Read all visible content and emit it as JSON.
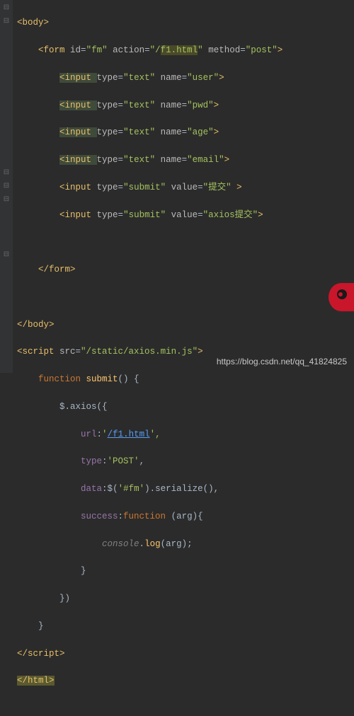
{
  "footer": "https://blog.csdn.net/qq_41824825",
  "fold": {
    "open": "⊟",
    "closed": "⊟",
    "leaf": ""
  },
  "code": {
    "l1": {
      "tag_open": "<body>"
    },
    "l2": {
      "indent": "    ",
      "open": "<form ",
      "a1n": "id",
      "a1v": "\"fm\"",
      "a2n": "action",
      "a2v1": "\"/",
      "a2v_hl": "f1.html",
      "a2v2": "\"",
      "a3n": "method",
      "a3v": "\"post\"",
      "close": ">"
    },
    "l3": {
      "indent": "        ",
      "open": "<input ",
      "a1n": "type",
      "a1v": "\"text\"",
      "a2n": "name",
      "a2v": "\"user\"",
      "close": ">"
    },
    "l4": {
      "indent": "        ",
      "open": "<input ",
      "a1n": "type",
      "a1v": "\"text\"",
      "a2n": "name",
      "a2v": "\"pwd\"",
      "close": ">"
    },
    "l5": {
      "indent": "        ",
      "open": "<input ",
      "a1n": "type",
      "a1v": "\"text\"",
      "a2n": "name",
      "a2v": "\"age\"",
      "close": ">"
    },
    "l6": {
      "indent": "        ",
      "open": "<input ",
      "a1n": "type",
      "a1v": "\"text\"",
      "a2n": "name",
      "a2v": "\"email\"",
      "close": ">"
    },
    "l7": {
      "indent": "        ",
      "open": "<input ",
      "a1n": "type",
      "a1v": "\"submit\"",
      "a2n": "value",
      "a2v": "\"提交\"",
      "close": " >"
    },
    "l8": {
      "indent": "        ",
      "open": "<input ",
      "a1n": "type",
      "a1v": "\"submit\"",
      "a2n": "value",
      "a2v": "\"axios提交\"",
      "close": ">"
    },
    "l9": "",
    "l10": {
      "indent": "    ",
      "tag": "</form>"
    },
    "l11": "",
    "l12": {
      "tag": "</body>"
    },
    "l13": {
      "open": "<script ",
      "a1n": "src",
      "a1v": "\"/static/axios.min.js\"",
      "close": ">"
    },
    "l14": {
      "indent": "    ",
      "kw": "function ",
      "name": "submit",
      "rest": "() {"
    },
    "l15": {
      "indent": "        ",
      "obj": "$",
      "rest": ".axios({"
    },
    "l16": {
      "indent": "            ",
      "prop": "url",
      "colon": ":",
      "q1": "'",
      "link": "/f1.html",
      "q2": "',",
      "trail": ""
    },
    "l17": {
      "indent": "            ",
      "prop": "type",
      "colon": ":",
      "val": "'POST'",
      "trail": ","
    },
    "l18": {
      "indent": "            ",
      "prop": "data",
      "colon": ":",
      "obj": "$",
      "p1": "(",
      "arg": "'#fm'",
      "p2": ").serialize(),"
    },
    "l19": {
      "indent": "            ",
      "prop": "success",
      "colon": ":",
      "kw": "function ",
      "rest": "(arg){"
    },
    "l20": {
      "indent": "                ",
      "obj": "console",
      "dot": ".",
      "fn": "log",
      "rest": "(arg);"
    },
    "l21": {
      "indent": "            ",
      "brace": "}"
    },
    "l22": {
      "indent": "        ",
      "brace": "})"
    },
    "l23": {
      "indent": "    ",
      "brace": "}"
    },
    "l24": {
      "tag": "</script>"
    },
    "l25": {
      "tag": "</html>"
    }
  }
}
